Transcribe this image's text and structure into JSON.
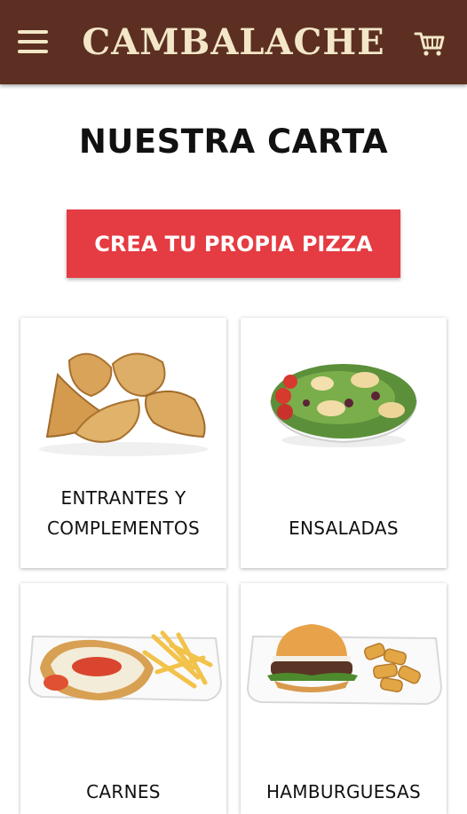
{
  "header": {
    "title": "CAMBALACHE",
    "menu_icon": "hamburger-menu-icon",
    "cart_icon": "shopping-cart-icon",
    "background": "#5c2f22",
    "title_color": "#f3e7c8"
  },
  "page": {
    "title": "NUESTRA CARTA"
  },
  "cta": {
    "label": "CREA TU PROPIA PIZZA",
    "color": "#e53b42"
  },
  "categories": [
    {
      "label_line1": "ENTRANTES Y",
      "label_line2": "COMPLEMENTOS",
      "image": "empanadas"
    },
    {
      "label_line1": "ENSALADAS",
      "image": "salad-bowl"
    },
    {
      "label_line1": "CARNES",
      "image": "milanesa-with-fries"
    },
    {
      "label_line1": "HAMBURGUESAS",
      "image": "burger-with-potatoes"
    }
  ]
}
